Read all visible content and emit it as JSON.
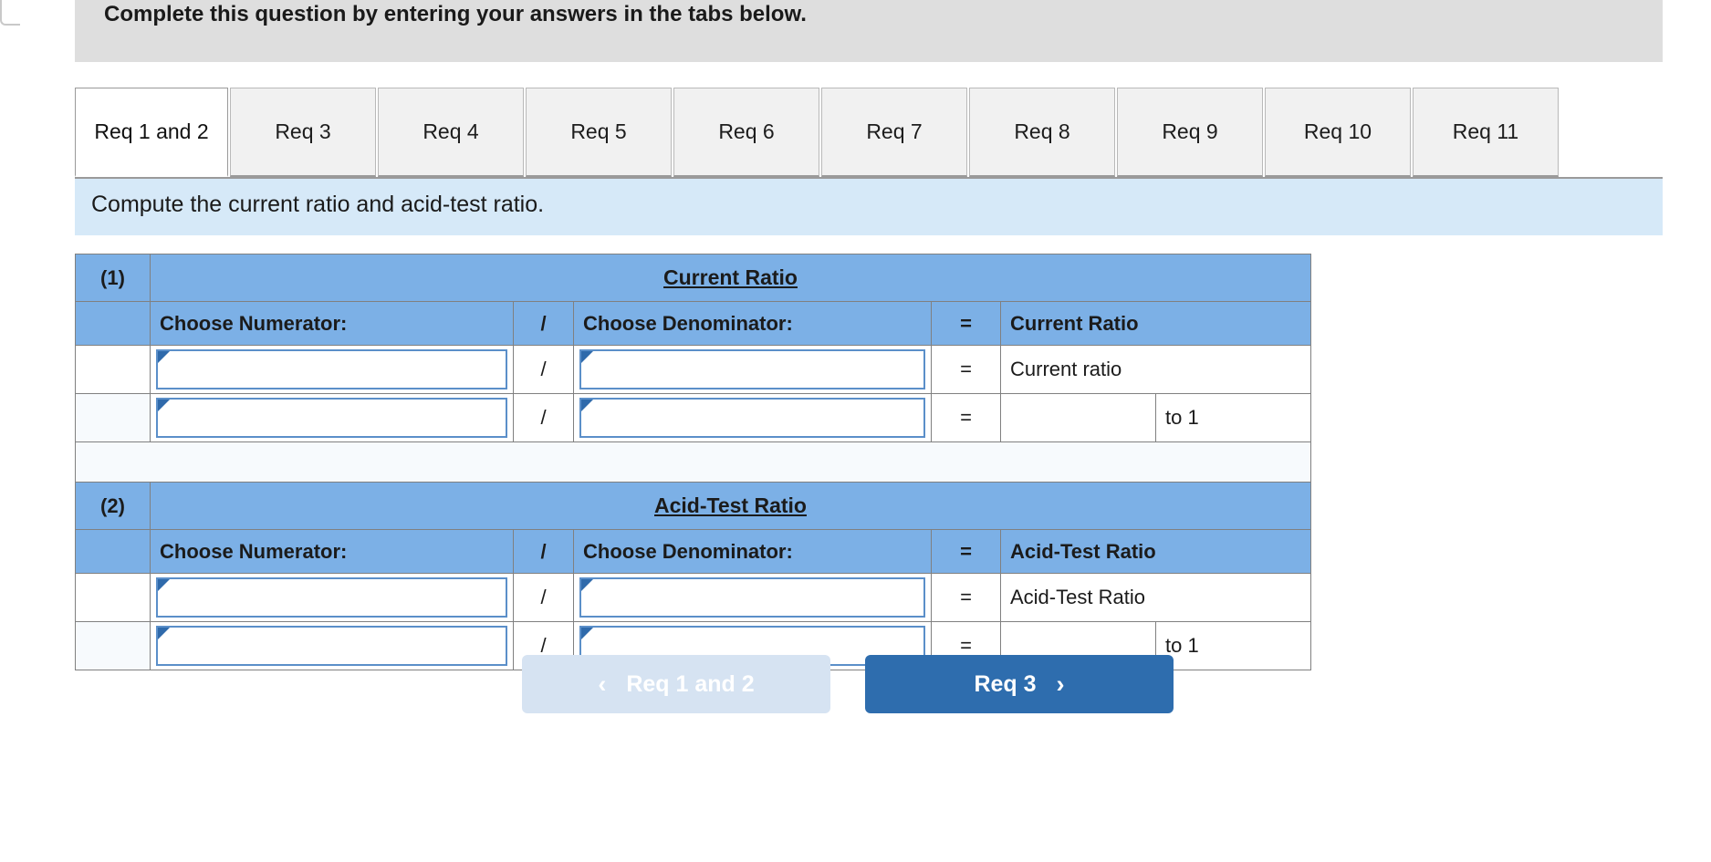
{
  "banner": {
    "text": "Complete this question by entering your answers in the tabs below."
  },
  "tabs": [
    {
      "label": "Req 1 and 2",
      "active": true
    },
    {
      "label": "Req 3",
      "active": false
    },
    {
      "label": "Req 4",
      "active": false
    },
    {
      "label": "Req 5",
      "active": false
    },
    {
      "label": "Req 6",
      "active": false
    },
    {
      "label": "Req 7",
      "active": false
    },
    {
      "label": "Req 8",
      "active": false
    },
    {
      "label": "Req 9",
      "active": false
    },
    {
      "label": "Req 10",
      "active": false
    },
    {
      "label": "Req 11",
      "active": false
    }
  ],
  "subinstruction": {
    "text": "Compute the current ratio and acid-test ratio."
  },
  "section1": {
    "index": "(1)",
    "title": "Current Ratio",
    "columns": {
      "numerator": "Choose Numerator:",
      "slash": "/",
      "denominator": "Choose Denominator:",
      "equals": "=",
      "result": "Current Ratio"
    },
    "rows": [
      {
        "numerator_value": "",
        "slash": "/",
        "denominator_value": "",
        "equals": "=",
        "result_label": "Current ratio",
        "result_value": "",
        "suffix": ""
      },
      {
        "numerator_value": "",
        "slash": "/",
        "denominator_value": "",
        "equals": "=",
        "result_label": "",
        "result_value": "",
        "suffix": "to 1"
      }
    ]
  },
  "section2": {
    "index": "(2)",
    "title": "Acid-Test Ratio",
    "columns": {
      "numerator": "Choose Numerator:",
      "slash": "/",
      "denominator": "Choose Denominator:",
      "equals": "=",
      "result": "Acid-Test Ratio"
    },
    "rows": [
      {
        "numerator_value": "",
        "slash": "/",
        "denominator_value": "",
        "equals": "=",
        "result_label": "Acid-Test Ratio",
        "result_value": "",
        "suffix": ""
      },
      {
        "numerator_value": "",
        "slash": "/",
        "denominator_value": "",
        "equals": "=",
        "result_label": "",
        "result_value": "",
        "suffix": "to 1"
      }
    ]
  },
  "nav": {
    "prev_label": "Req 1 and 2",
    "prev_icon": "chevron-left-icon",
    "prev_chevron": "‹",
    "next_label": "Req 3",
    "next_icon": "chevron-right-icon",
    "next_chevron": "›"
  },
  "colors": {
    "header_blue": "#7cb0e6",
    "banner_grey": "#dedede",
    "instruction_blue": "#d6e9f8",
    "primary_button": "#2e6dae",
    "disabled_button": "#d6e3f2",
    "input_border": "#5b8fc9",
    "marker_blue": "#2f6aab"
  }
}
